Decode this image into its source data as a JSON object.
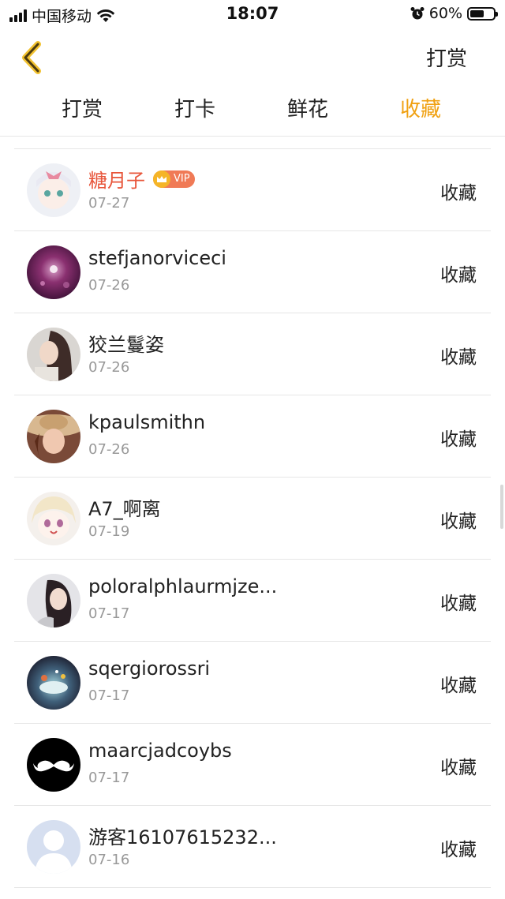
{
  "status_bar": {
    "carrier": "中国移动",
    "time": "18:07",
    "battery": "60%",
    "battery_level": 0.6
  },
  "nav": {
    "action_label": "打赏"
  },
  "tabs": [
    {
      "label": "打赏",
      "active": false
    },
    {
      "label": "打卡",
      "active": false
    },
    {
      "label": "鲜花",
      "active": false
    },
    {
      "label": "收藏",
      "active": true
    }
  ],
  "colors": {
    "accent": "#f0a010",
    "vip_name": "#e8553a"
  },
  "vip_label": "VIP",
  "list": [
    {
      "name": "糖月子",
      "date": "07-27",
      "action": "收藏",
      "vip": true
    },
    {
      "name": "stefjanorviceci",
      "date": "07-26",
      "action": "收藏"
    },
    {
      "name": "狡兰鬘姿",
      "date": "07-26",
      "action": "收藏"
    },
    {
      "name": "kpaulsmithn",
      "date": "07-26",
      "action": "收藏"
    },
    {
      "name": "A7_啊离",
      "date": "07-19",
      "action": "收藏"
    },
    {
      "name": "poloralphlaurmjze...",
      "date": "07-17",
      "action": "收藏"
    },
    {
      "name": "sqergiorossri",
      "date": "07-17",
      "action": "收藏"
    },
    {
      "name": "maarcjadcoybs",
      "date": "07-17",
      "action": "收藏"
    },
    {
      "name": "游客16107615232...",
      "date": "07-16",
      "action": "收藏"
    }
  ]
}
